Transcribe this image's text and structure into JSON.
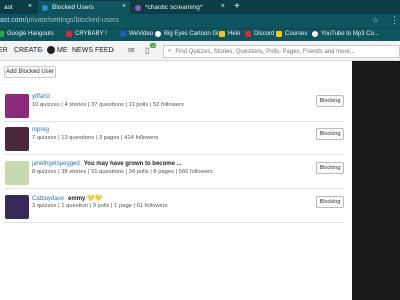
{
  "browser": {
    "tabs": [
      {
        "label": "ast",
        "close": "×"
      },
      {
        "label": "Blocked Users",
        "close": "×"
      },
      {
        "label": "*chaotic screaming*",
        "close": "×"
      }
    ],
    "new_tab": "+",
    "url_prefix": "ast.com/",
    "url_path": "private/settings/blocked-users",
    "bookmarks": [
      {
        "label": "Google Hangouts",
        "color": "#2e9e4f"
      },
      {
        "label": "CRYBABY !",
        "color": "#d32f2f"
      },
      {
        "label": "WeVideo",
        "color": "#1e5fb4"
      },
      {
        "label": "Big Eyes Cartoon Gi...",
        "color": "#ffffff"
      },
      {
        "label": "Helo",
        "color": "#f5c518"
      },
      {
        "label": "Discord",
        "color": "#d32f2f"
      },
      {
        "label": "Courses",
        "color": "#f5c518"
      },
      {
        "label": "YouTube to Mp3 Co...",
        "color": "#ffffff"
      }
    ]
  },
  "header": {
    "nav": [
      "ER",
      "CREATE",
      "ME",
      "NEWS FEED"
    ],
    "notification_count": "12",
    "search_placeholder": "Find Quizzes, Stories, Questions, Polls, Pages, Friends and more..."
  },
  "page": {
    "add_button": "Add Blocked User",
    "block_label": "Blocking",
    "users": [
      {
        "name": "ytffart2",
        "title": "",
        "stats": "10 quizzes | 4 stories | 37 questions | 11 polls | 52 followers",
        "avatar_color": "#8a2b7a"
      },
      {
        "name": "mpreg",
        "title": "",
        "stats": "7 quizzes | 13 questions | 3 pages | 414 followers",
        "avatar_color": "#4a2a3a"
      },
      {
        "name": "janethgetspegged",
        "title": "You may have grown to become ...",
        "stats": "8 quizzes | 38 stories | 51 questions | 34 polls | 8 pages | 566 followers",
        "avatar_color": "#c8d8b0"
      },
      {
        "name": "Catboydave",
        "title": "emmy 💛💛",
        "stats": "3 quizzes | 1 question | 9 polls | 1 page | 61 followers",
        "avatar_color": "#3a2a5a"
      }
    ]
  }
}
